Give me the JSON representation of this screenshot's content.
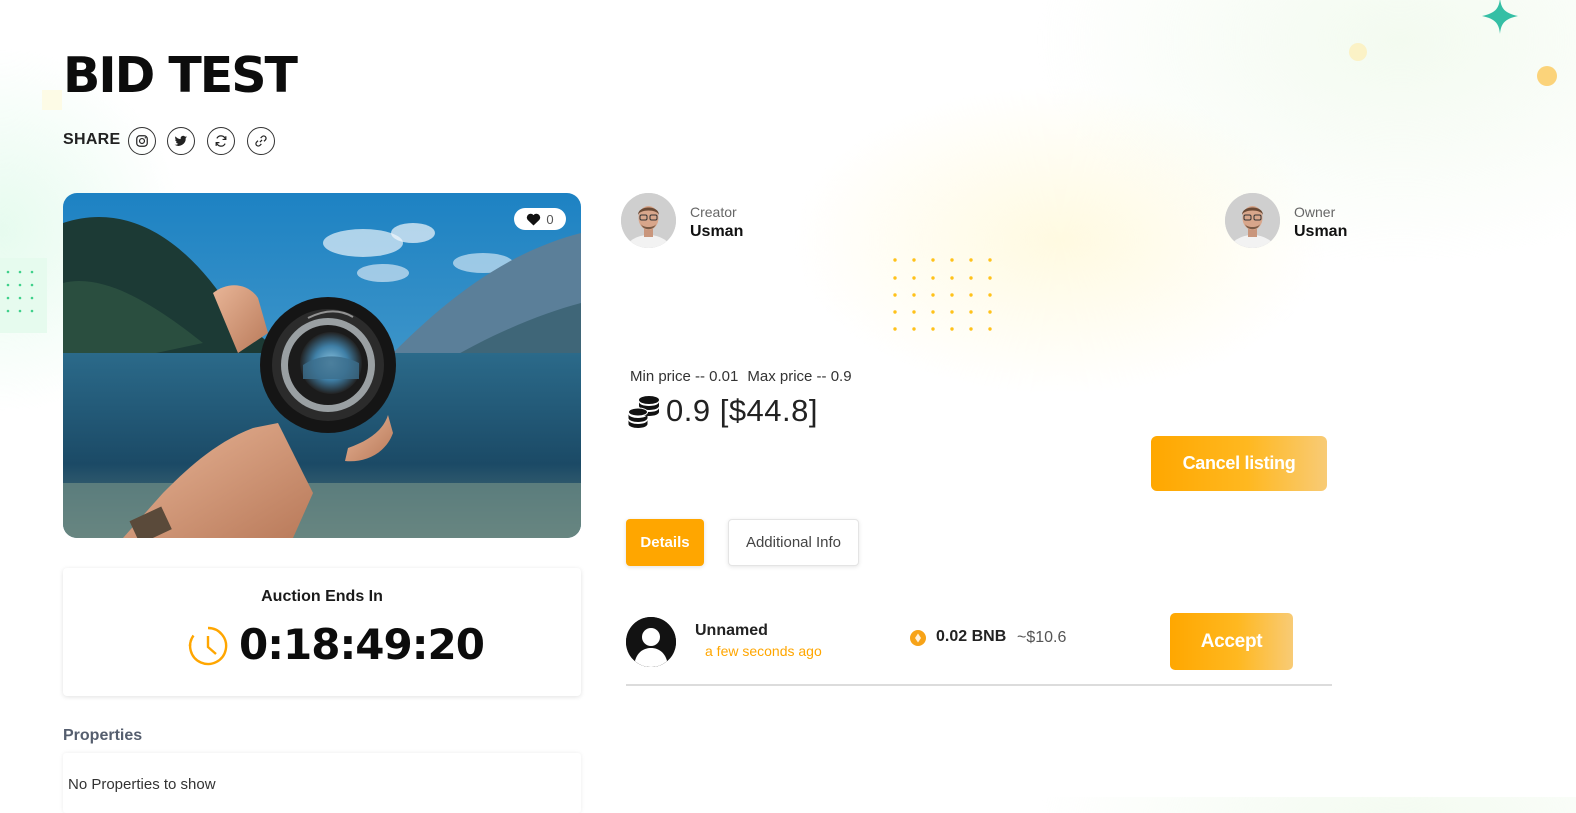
{
  "page": {
    "title": "BID TEST",
    "share_label": "SHARE",
    "share_icons": [
      "instagram-icon",
      "twitter-icon",
      "refresh-icon",
      "link-icon"
    ]
  },
  "media": {
    "likes": "0"
  },
  "auction": {
    "label": "Auction Ends In",
    "countdown": "0:18:49:20"
  },
  "properties": {
    "label": "Properties",
    "empty_text": "No Properties to show"
  },
  "creator": {
    "role": "Creator",
    "name": "Usman"
  },
  "owner": {
    "role": "Owner",
    "name": "Usman"
  },
  "price": {
    "min": "Min price -- 0.01",
    "max": "Max price -- 0.9",
    "current": "0.9 [$44.8]"
  },
  "actions": {
    "cancel_label": "Cancel listing"
  },
  "tabs": [
    {
      "label": "Details",
      "active": true
    },
    {
      "label": "Additional Info",
      "active": false
    }
  ],
  "bids": [
    {
      "bidder": "Unnamed",
      "time": "a few seconds ago",
      "amount": "0.02 BNB",
      "usd": "~$10.6",
      "accept_label": "Accept"
    }
  ],
  "colors": {
    "accent": "#ffa600",
    "accent_light": "#f8cb76",
    "teal_sparkle": "#35bfa5",
    "text_dark": "#0c0c0c"
  }
}
